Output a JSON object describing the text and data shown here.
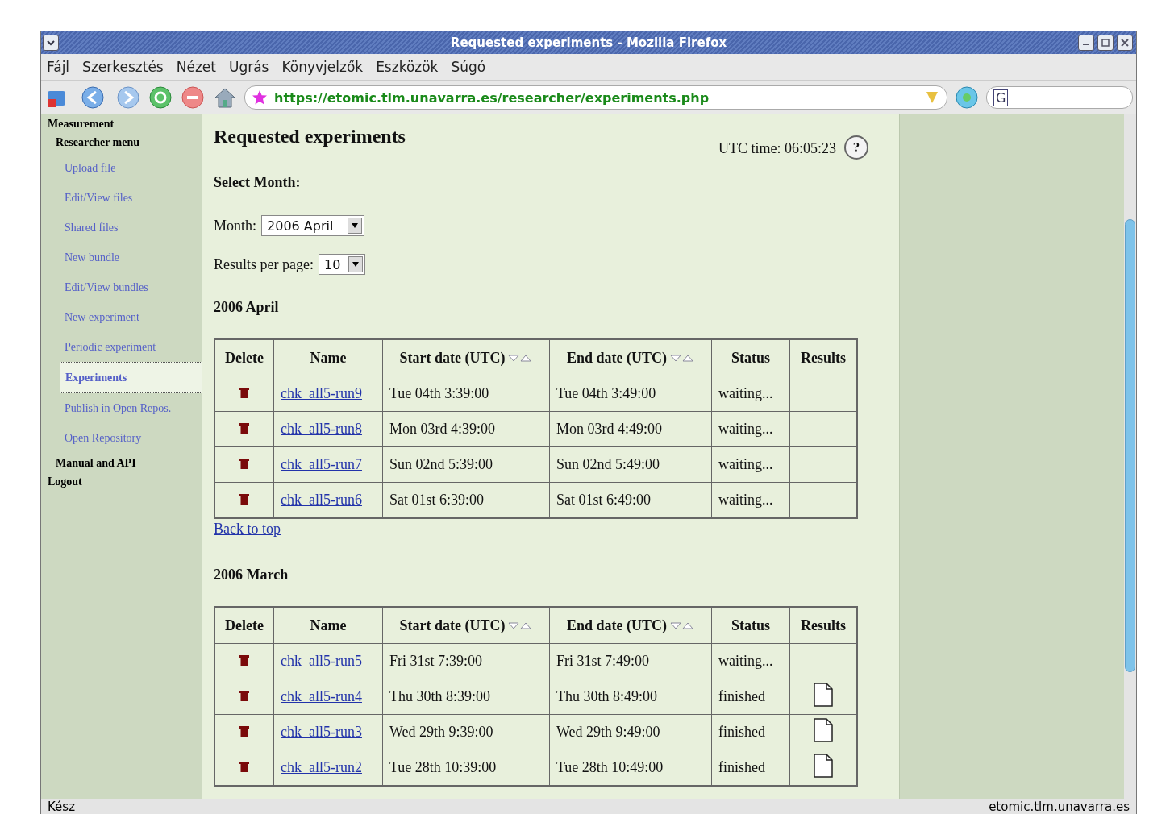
{
  "window": {
    "title": "Requested experiments - Mozilla Firefox"
  },
  "menu": [
    {
      "label": "Fájl"
    },
    {
      "label": "Szerkesztés"
    },
    {
      "label": "Nézet"
    },
    {
      "label": "Ugrás"
    },
    {
      "label": "Könyvjelzők"
    },
    {
      "label": "Eszközök"
    },
    {
      "label": "Súgó"
    }
  ],
  "address": {
    "value": "https://etomic.tlm.unavarra.es/researcher/experiments.php"
  },
  "search_box": {
    "value": "G"
  },
  "sidebar": {
    "items": [
      {
        "label": "Measurement",
        "kind": "section",
        "children": [
          {
            "label": "Researcher menu",
            "kind": "section",
            "children": [
              {
                "label": "Upload file",
                "kind": "link",
                "selected": false
              },
              {
                "label": "Edit/View files",
                "kind": "link",
                "selected": false
              },
              {
                "label": "Shared files",
                "kind": "link",
                "selected": false
              },
              {
                "label": "New bundle",
                "kind": "link",
                "selected": false
              },
              {
                "label": "Edit/View bundles",
                "kind": "link",
                "selected": false
              },
              {
                "label": "New experiment",
                "kind": "link",
                "selected": false
              },
              {
                "label": "Periodic experiment",
                "kind": "link",
                "selected": false
              },
              {
                "label": "Experiments",
                "kind": "link",
                "selected": true
              },
              {
                "label": "Publish in Open Repos.",
                "kind": "link",
                "selected": false
              },
              {
                "label": "Open Repository",
                "kind": "link",
                "selected": false
              }
            ]
          },
          {
            "label": "Manual and API",
            "kind": "section"
          }
        ]
      },
      {
        "label": "Logout",
        "kind": "section"
      }
    ]
  },
  "page": {
    "title": "Requested experiments",
    "utc_time": "UTC time: 06:05:23",
    "help": "?",
    "select_heading": "Select Month:",
    "month_label": "Month:",
    "month_value": "2006 April",
    "per_page_label": "Results per page:",
    "per_page_value": "10"
  },
  "months": [
    {
      "heading": "2006 April",
      "back_link": "Back to top",
      "columns": [
        "Delete",
        "Name",
        "Start date (UTC)",
        "End date (UTC)",
        "Status",
        "Results"
      ],
      "rows": [
        {
          "name": "chk_all5-run9",
          "start": "Tue 04th 3:39:00",
          "end": "Tue 04th 3:49:00",
          "status": "waiting...",
          "has_result": false
        },
        {
          "name": "chk_all5-run8",
          "start": "Mon 03rd 4:39:00",
          "end": "Mon 03rd 4:49:00",
          "status": "waiting...",
          "has_result": false
        },
        {
          "name": "chk_all5-run7",
          "start": "Sun 02nd 5:39:00",
          "end": "Sun 02nd 5:49:00",
          "status": "waiting...",
          "has_result": false
        },
        {
          "name": "chk_all5-run6",
          "start": "Sat 01st 6:39:00",
          "end": "Sat 01st 6:49:00",
          "status": "waiting...",
          "has_result": false
        }
      ]
    },
    {
      "heading": "2006 March",
      "columns": [
        "Delete",
        "Name",
        "Start date (UTC)",
        "End date (UTC)",
        "Status",
        "Results"
      ],
      "rows": [
        {
          "name": "chk_all5-run5",
          "start": "Fri 31st 7:39:00",
          "end": "Fri 31st 7:49:00",
          "status": "waiting...",
          "has_result": false
        },
        {
          "name": "chk_all5-run4",
          "start": "Thu 30th 8:39:00",
          "end": "Thu 30th 8:49:00",
          "status": "finished",
          "has_result": true
        },
        {
          "name": "chk_all5-run3",
          "start": "Wed 29th 9:39:00",
          "end": "Wed 29th 9:49:00",
          "status": "finished",
          "has_result": true
        },
        {
          "name": "chk_all5-run2",
          "start": "Tue 28th 10:39:00",
          "end": "Tue 28th 10:49:00",
          "status": "finished",
          "has_result": true
        }
      ]
    }
  ],
  "status_bar": {
    "left": "Kész",
    "right": "etomic.tlm.unavarra.es"
  }
}
